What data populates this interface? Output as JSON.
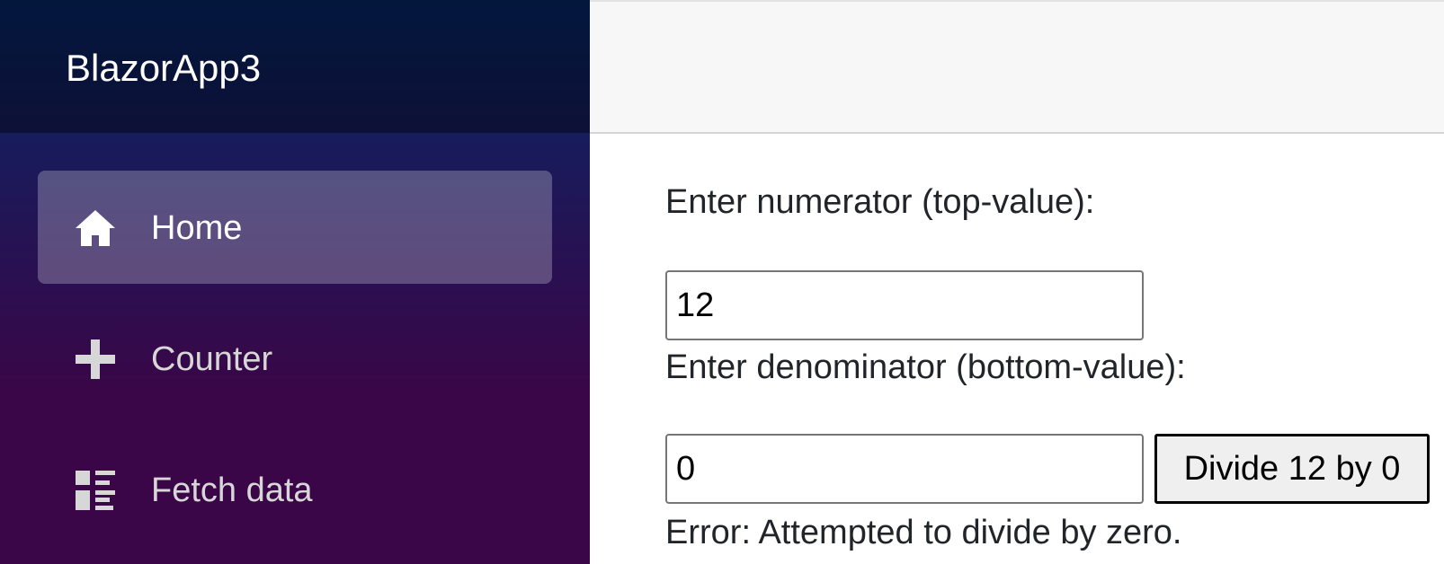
{
  "app": {
    "brand": "BlazorApp3"
  },
  "sidebar": {
    "items": [
      {
        "label": "Home",
        "icon": "home-icon",
        "active": true
      },
      {
        "label": "Counter",
        "icon": "plus-icon",
        "active": false
      },
      {
        "label": "Fetch data",
        "icon": "list-rich-icon",
        "active": false
      }
    ]
  },
  "form": {
    "numerator_label": "Enter numerator (top-value):",
    "numerator_value": "12",
    "denominator_label": "Enter denominator (bottom-value):",
    "denominator_value": "0",
    "divide_button_label": "Divide 12 by 0",
    "error_message": "Error: Attempted to divide by zero."
  },
  "colors": {
    "sidebar_gradient_top": "#052767",
    "sidebar_gradient_bottom": "#3a0647",
    "top_row_background": "#f7f7f7",
    "text": "#212529"
  }
}
